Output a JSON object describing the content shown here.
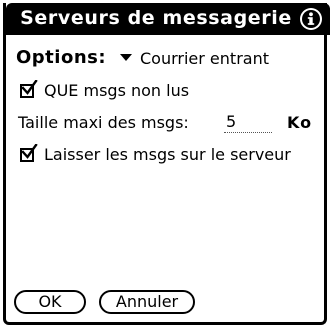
{
  "dialog": {
    "title": "Serveurs de messagerie",
    "info_icon": "info-icon"
  },
  "options": {
    "label": "Options:",
    "selected": "Courrier entrant",
    "dropdown_icon": "triangle-down-icon"
  },
  "settings": {
    "unread_only": {
      "label": "QUE msgs non lus",
      "checked": true
    },
    "max_size": {
      "label": "Taille maxi des msgs:",
      "value": "5",
      "unit": "Ko"
    },
    "leave_on_server": {
      "label": "Laisser les msgs sur le serveur",
      "checked": true
    }
  },
  "buttons": {
    "ok": "OK",
    "cancel": "Annuler"
  }
}
